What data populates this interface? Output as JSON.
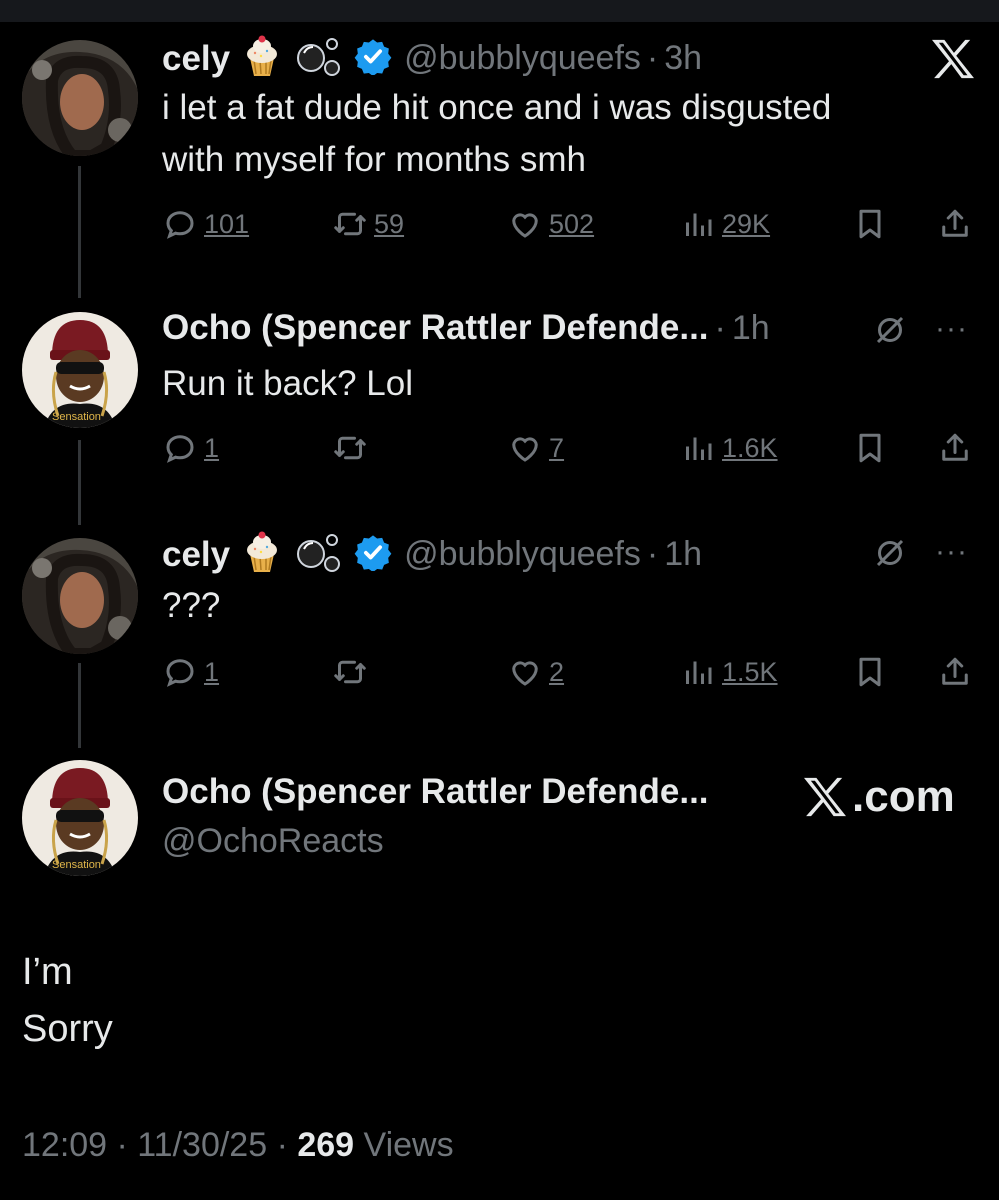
{
  "colors": {
    "background": "#000000",
    "text": "#e7e9ea",
    "muted": "#71767b",
    "verified": "#1d9bf0"
  },
  "tweets": [
    {
      "name": "cely",
      "handle": "@bubblyqueefs",
      "time": "3h",
      "text_lines": [
        "i let a fat dude hit once and i was disgusted",
        "with myself for months smh"
      ],
      "replies": "101",
      "retweets": "59",
      "likes": "502",
      "views": "29K",
      "top_right": "x-logo-icon"
    },
    {
      "name": "Ocho (Spencer Rattler Defende...",
      "time": "1h",
      "text_lines": [
        "Run it back? Lol"
      ],
      "replies": "1",
      "retweets": "",
      "likes": "7",
      "views": "1.6K",
      "avatar_caption": "Sensation"
    },
    {
      "name": "cely",
      "handle": "@bubblyqueefs",
      "time": "1h",
      "text_lines": [
        "???"
      ],
      "replies": "1",
      "retweets": "",
      "likes": "2",
      "views": "1.5K"
    }
  ],
  "main_tweet": {
    "name": "Ocho (Spencer Rattler Defende...",
    "handle": "@OchoReacts",
    "brand": ".com",
    "text_lines": [
      "I’m",
      "Sorry"
    ],
    "timestamp": "12:09 · 11/30/25 ·",
    "views_count": "269",
    "views_label": "Views",
    "avatar_caption": "Sensation"
  },
  "separator": "·",
  "more_label": "···"
}
